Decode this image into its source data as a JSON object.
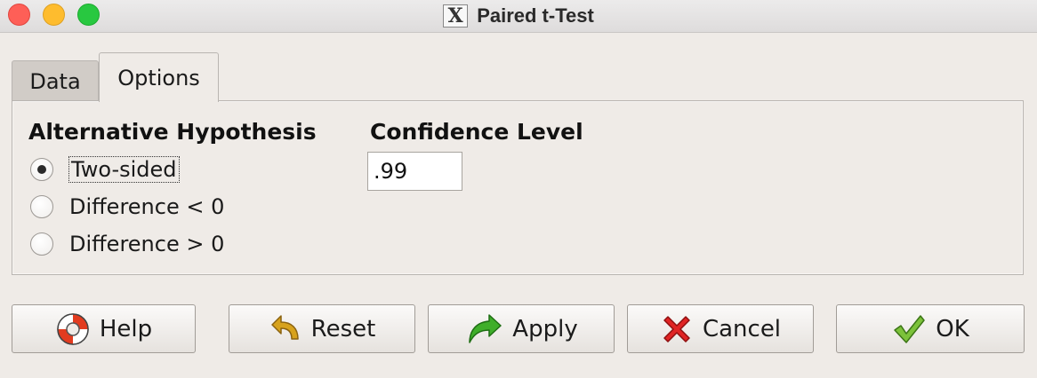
{
  "window": {
    "title": "Paired t-Test",
    "app_icon": "x11-icon"
  },
  "tabs": [
    {
      "label": "Data",
      "selected": false
    },
    {
      "label": "Options",
      "selected": true
    }
  ],
  "options": {
    "alternative_heading": "Alternative Hypothesis",
    "alternatives": [
      {
        "label": "Two-sided",
        "selected": true
      },
      {
        "label": "Difference < 0",
        "selected": false
      },
      {
        "label": "Difference > 0",
        "selected": false
      }
    ],
    "confidence_heading": "Confidence Level",
    "confidence_value": ".99"
  },
  "buttons": {
    "help": {
      "label": "Help",
      "icon": "lifebuoy-icon"
    },
    "reset": {
      "label": "Reset",
      "icon": "undo-arrow-icon"
    },
    "apply": {
      "label": "Apply",
      "icon": "forward-arrow-icon"
    },
    "cancel": {
      "label": "Cancel",
      "icon": "red-x-icon"
    },
    "ok": {
      "label": "OK",
      "icon": "checkmark-icon"
    }
  }
}
